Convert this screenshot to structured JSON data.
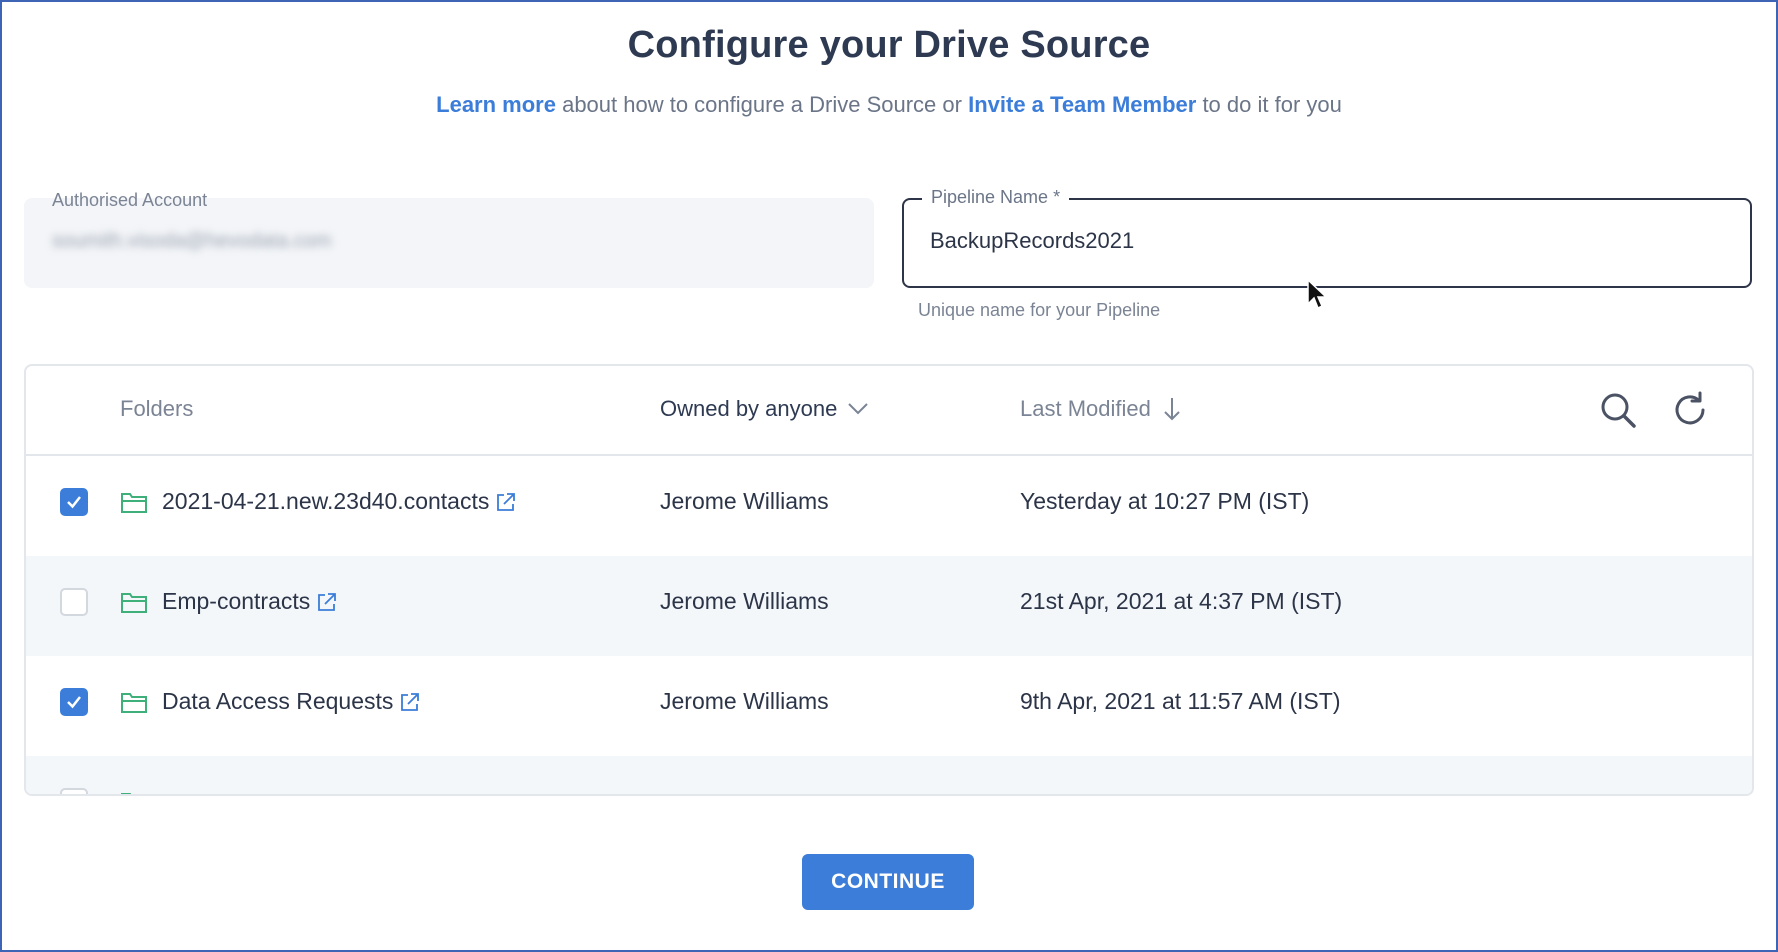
{
  "header": {
    "title": "Configure your Drive Source",
    "learn_more": "Learn more",
    "middle_text": " about how to configure a Drive Source or ",
    "invite": "Invite a Team Member",
    "tail_text": " to do it for you"
  },
  "auth_account": {
    "label": "Authorised Account",
    "value": "soumith.visoda@hevodata.com"
  },
  "pipeline": {
    "label": "Pipeline Name *",
    "value": "BackupRecords2021",
    "hint": "Unique name for your Pipeline"
  },
  "table": {
    "headers": {
      "folders": "Folders",
      "owner": "Owned by anyone",
      "modified": "Last Modified"
    },
    "rows": [
      {
        "checked": true,
        "name": "2021-04-21.new.23d40.contacts",
        "owner": "Jerome Williams",
        "modified": "Yesterday at 10:27 PM (IST)"
      },
      {
        "checked": false,
        "name": "Emp-contracts",
        "owner": "Jerome Williams",
        "modified": "21st Apr, 2021 at 4:37 PM (IST)"
      },
      {
        "checked": true,
        "name": "Data Access Requests",
        "owner": "Jerome Williams",
        "modified": "9th Apr, 2021 at 11:57 AM (IST)"
      }
    ]
  },
  "actions": {
    "continue": "CONTINUE"
  },
  "colors": {
    "accent": "#3b7dd8",
    "folder_icon": "#3fb07a",
    "frame": "#3d64b5"
  },
  "icons": [
    "search-icon",
    "refresh-icon",
    "chevron-down-icon",
    "arrow-down-icon",
    "folder-icon",
    "external-link-icon",
    "check-icon"
  ]
}
